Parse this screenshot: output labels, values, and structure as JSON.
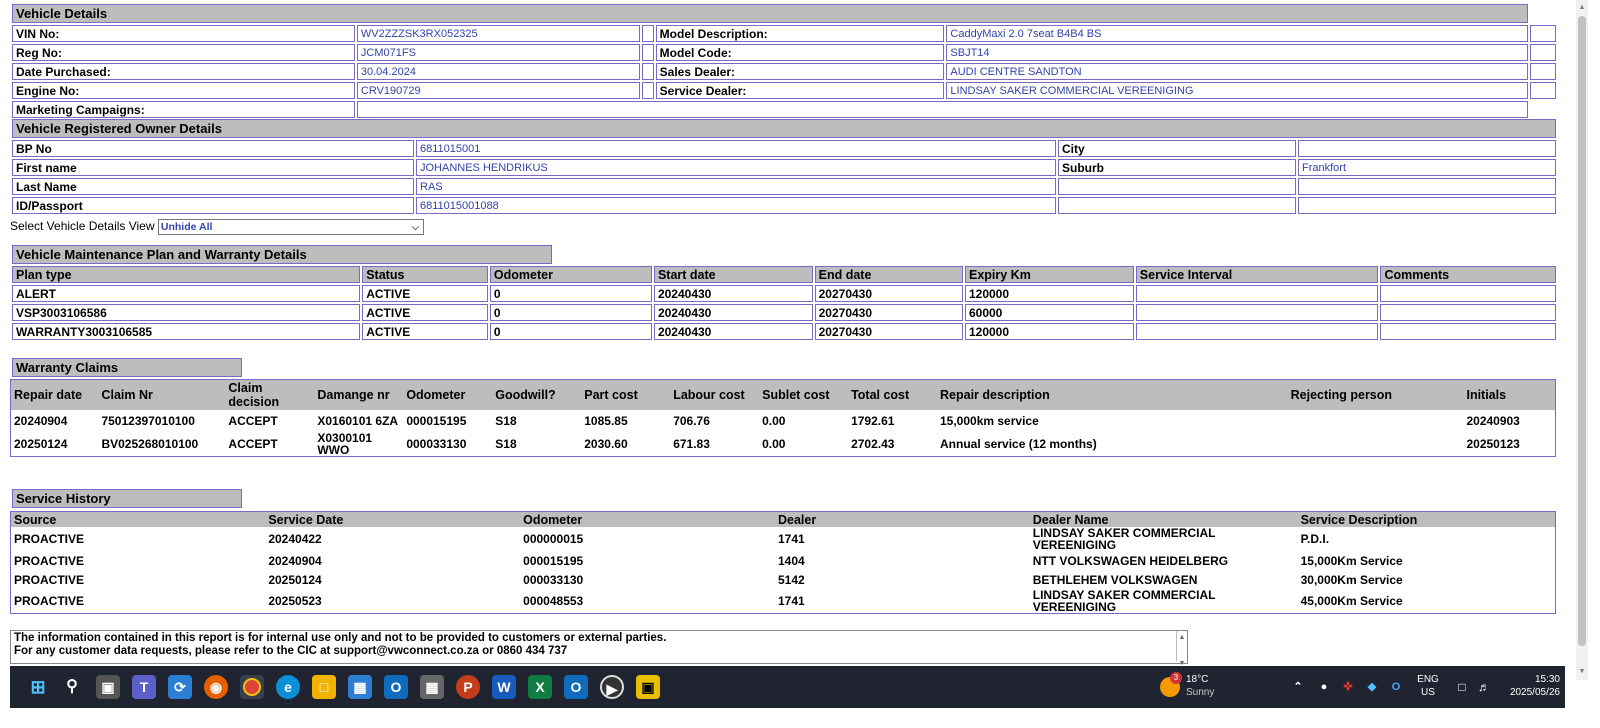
{
  "vehicle": {
    "title": "Vehicle Details",
    "vin_label": "VIN No:",
    "vin": "WV2ZZZSK3RX052325",
    "reg_label": "Reg No:",
    "reg": "JCM071FS",
    "date_label": "Date Purchased:",
    "date": "30.04.2024",
    "engine_label": "Engine No:",
    "engine": "CRV190729",
    "campaigns_label": "Marketing Campaigns:",
    "model_desc_label": "Model Description:",
    "model_desc": "CaddyMaxi 2.0 7seat B4B4 BS",
    "model_code_label": "Model Code:",
    "model_code": "SBJT14",
    "sales_label": "Sales Dealer:",
    "sales": "AUDI CENTRE SANDTON",
    "service_label": "Service Dealer:",
    "service": "LINDSAY SAKER COMMERCIAL VEREENIGING"
  },
  "owner": {
    "title": "Vehicle Registered Owner Details",
    "bp_label": "BP No",
    "bp": "6811015001",
    "first_label": "First name",
    "first": "JOHANNES HENDRIKUS",
    "last_label": "Last Name",
    "last": "RAS",
    "id_label": "ID/Passport",
    "id": "6811015001088",
    "city_label": "City",
    "suburb_label": "Suburb",
    "suburb": "Frankfort"
  },
  "view_select": {
    "label": "Select Vehicle Details View",
    "value": "Unhide All"
  },
  "maintenance": {
    "title": "Vehicle Maintenance Plan and Warranty Details",
    "headers": [
      "Plan type",
      "Status",
      "Odometer",
      "Start date",
      "End date",
      "Expiry Km",
      "Service Interval",
      "Comments"
    ],
    "rows": [
      [
        "ALERT",
        "ACTIVE",
        "0",
        "20240430",
        "20270430",
        "120000",
        "",
        ""
      ],
      [
        "VSP3003106586",
        "ACTIVE",
        "0",
        "20240430",
        "20270430",
        "60000",
        "",
        ""
      ],
      [
        "WARRANTY3003106585",
        "ACTIVE",
        "0",
        "20240430",
        "20270430",
        "120000",
        "",
        ""
      ]
    ]
  },
  "claims": {
    "title": "Warranty Claims",
    "headers": [
      "Repair date",
      "Claim Nr",
      "Claim decision",
      "Damange nr",
      "Odometer",
      "Goodwill?",
      "Part cost",
      "Labour cost",
      "Sublet cost",
      "Total cost",
      "Repair description",
      "Rejecting person",
      "Initials"
    ],
    "rows": [
      [
        "20240904",
        "75012397010100",
        "ACCEPT",
        "X0160101 6ZA",
        "000015195",
        "S18",
        "1085.85",
        "706.76",
        "0.00",
        "1792.61",
        "15,000km service",
        "",
        "20240903"
      ],
      [
        "20250124",
        "BV025268010100",
        "ACCEPT",
        "X0300101 WWO",
        "000033130",
        "S18",
        "2030.60",
        "671.83",
        "0.00",
        "2702.43",
        "Annual service (12 months)",
        "",
        "20250123"
      ]
    ]
  },
  "history": {
    "title": "Service History",
    "headers": [
      "Source",
      "Service Date",
      "Odometer",
      "Dealer",
      "Dealer Name",
      "Service Description"
    ],
    "rows": [
      [
        "PROACTIVE",
        "20240422",
        "000000015",
        "1741",
        "LINDSAY SAKER COMMERCIAL VEREENIGING",
        "P.D.I."
      ],
      [
        "PROACTIVE",
        "20240904",
        "000015195",
        "1404",
        "NTT VOLKSWAGEN HEIDELBERG",
        "15,000Km Service"
      ],
      [
        "PROACTIVE",
        "20250124",
        "000033130",
        "5142",
        "BETHLEHEM VOLKSWAGEN",
        "30,000Km Service"
      ],
      [
        "PROACTIVE",
        "20250523",
        "000048553",
        "1741",
        "LINDSAY SAKER COMMERCIAL VEREENIGING",
        "45,000Km Service"
      ]
    ]
  },
  "notice": {
    "line1": "The information contained in this report is for internal use only and not to be provided to customers or external parties.",
    "line2": "For any customer data requests, please refer to the CIC at support@vwconnect.co.za or 0860 434 737"
  },
  "taskbar": {
    "weather_temp": "18°C",
    "weather_text": "Sunny",
    "weather_badge": "3",
    "lang": "ENG",
    "region": "US",
    "time": "15:30",
    "date": "2025/05/26"
  }
}
